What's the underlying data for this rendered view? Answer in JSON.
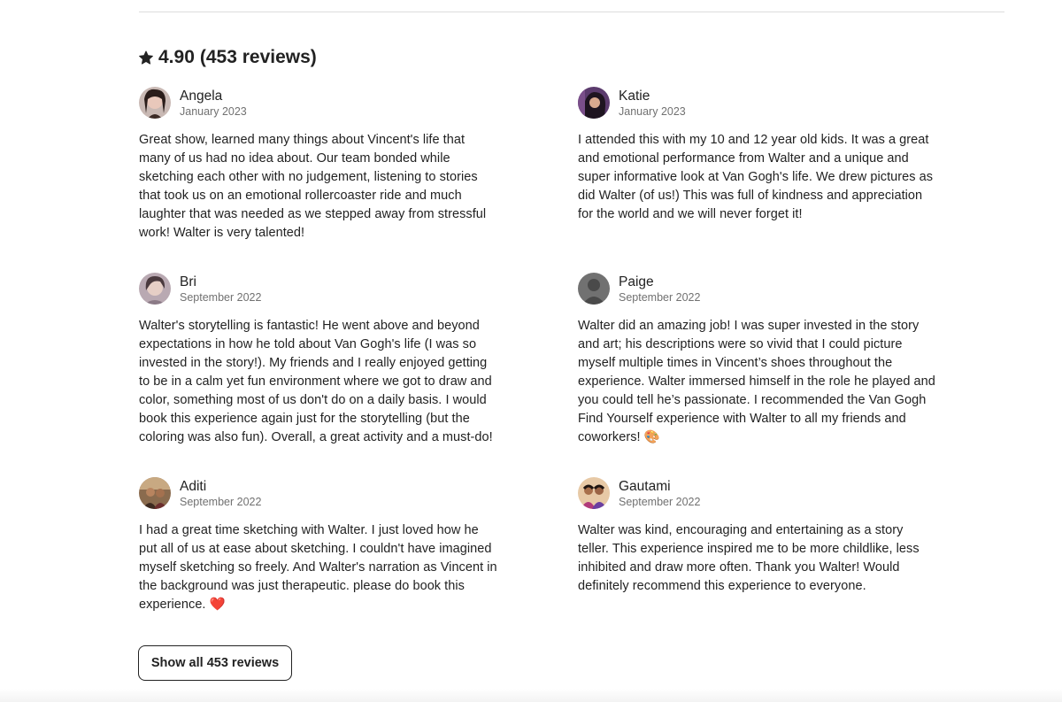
{
  "header": {
    "icon": "star-icon",
    "rating": "4.90",
    "count_text": "(453 reviews)"
  },
  "reviews": [
    {
      "name": "Angela",
      "date": "January 2023",
      "avatar": "avatar-photo",
      "text": "Great show, learned many things about Vincent's life that many of us had no idea about. Our team bonded while sketching each other with no judgement, listening to stories that took us on an emotional rollercoaster ride and much laughter that was needed as we stepped away from stressful work! Walter is very talented!"
    },
    {
      "name": "Katie",
      "date": "January 2023",
      "avatar": "avatar-photo",
      "text": "I attended this with my 10 and 12 year old kids. It was a great and emotional performance from Walter and a unique and super informative look at Van Gogh's life. We drew pictures as did Walter (of us!) This was full of kindness and appreciation for the world and we will never forget it!"
    },
    {
      "name": "Bri",
      "date": "September 2022",
      "avatar": "avatar-photo",
      "text": "Walter's storytelling is fantastic! He went above and beyond expectations in how he told about Van Gogh's life (I was so invested in the story!). My friends and I really enjoyed getting to be in a calm yet fun environment where we got to draw and color, something most of us don't do on a daily basis. I would book this experience again just for the storytelling (but the coloring was also fun). Overall, a great activity and a must-do!"
    },
    {
      "name": "Paige",
      "date": "September 2022",
      "avatar": "avatar-placeholder",
      "text": "Walter did an amazing job! I was super invested in the story and art; his descriptions were so vivid that I could picture myself multiple times in Vincent’s shoes throughout the experience. Walter immersed himself in the role he played and you could tell he’s passionate. I recommended the Van Gogh Find Yourself experience with Walter to all my friends and coworkers! 🎨"
    },
    {
      "name": "Aditi",
      "date": "September 2022",
      "avatar": "avatar-photo",
      "text": "I had a great time sketching with Walter. I just loved how he put all of us at ease about sketching. I couldn't have imagined myself sketching so freely. And Walter's narration as Vincent in the background was just therapeutic. please do book this experience. ❤️"
    },
    {
      "name": "Gautami",
      "date": "September 2022",
      "avatar": "avatar-photo",
      "text": "Walter was kind, encouraging and entertaining as a story teller. This experience inspired me to be more childlike, less inhibited and draw more often. Thank you Walter! Would definitely recommend this experience to everyone."
    }
  ],
  "show_all_button": "Show all 453 reviews",
  "colors": {
    "text": "#222222",
    "muted": "#717171",
    "divider": "#dddddd"
  }
}
